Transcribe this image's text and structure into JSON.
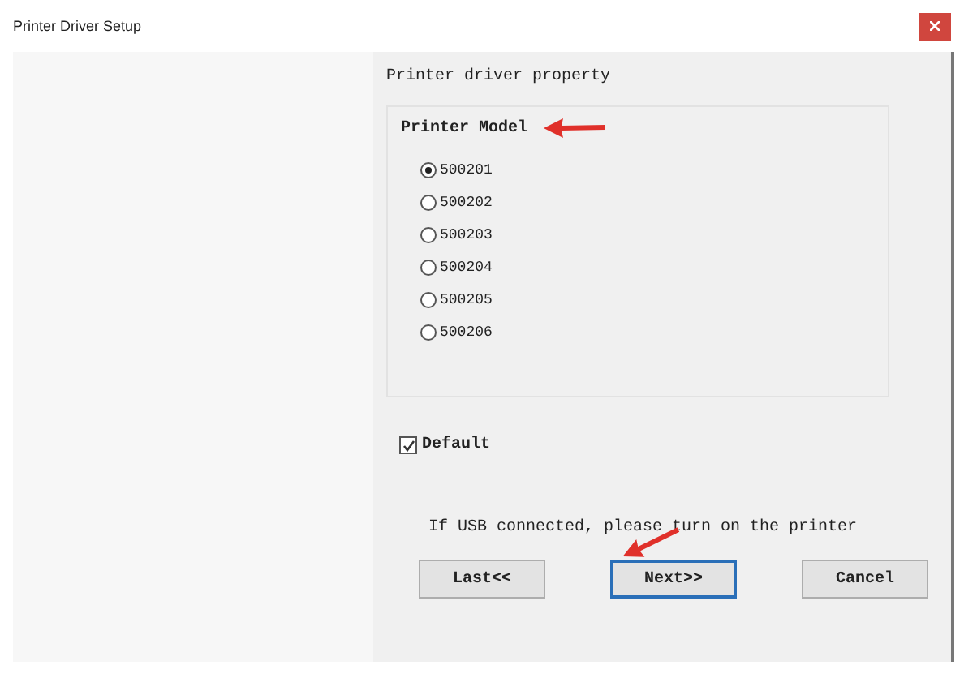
{
  "window": {
    "title": "Printer Driver Setup"
  },
  "section_title": "Printer driver property",
  "group": {
    "title": "Printer Model",
    "options": [
      {
        "label": "500201",
        "selected": true
      },
      {
        "label": "500202",
        "selected": false
      },
      {
        "label": "500203",
        "selected": false
      },
      {
        "label": "500204",
        "selected": false
      },
      {
        "label": "500205",
        "selected": false
      },
      {
        "label": "500206",
        "selected": false
      }
    ]
  },
  "default_checkbox": {
    "label": "Default",
    "checked": true
  },
  "message": "If USB connected, please turn on the printer",
  "buttons": [
    {
      "label": "Last<<",
      "focused": false
    },
    {
      "label": "Next>>",
      "focused": true
    },
    {
      "label": "Cancel",
      "focused": false
    }
  ]
}
